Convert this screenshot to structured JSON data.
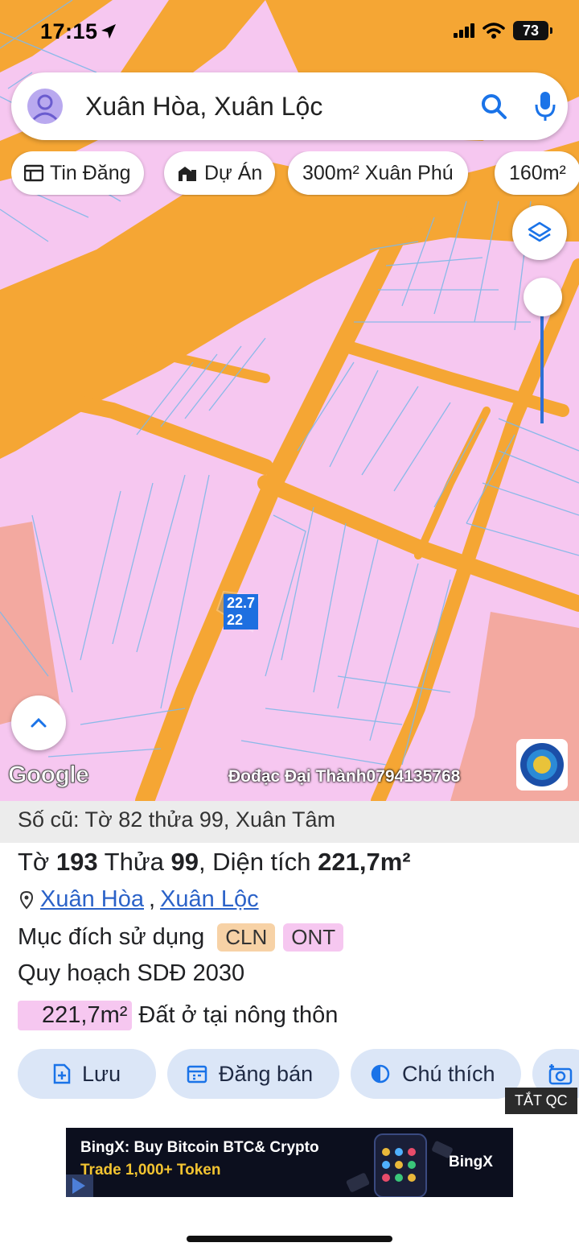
{
  "status_bar": {
    "time": "17:15",
    "battery": "73"
  },
  "search": {
    "value": "Xuân Hòa, Xuân Lộc"
  },
  "chips": [
    {
      "label": "Tin Đăng",
      "icon": "listing-icon"
    },
    {
      "label": "Dự Án",
      "icon": "building-icon"
    },
    {
      "label": "300m² Xuân Phú"
    },
    {
      "label": "160m²"
    }
  ],
  "map": {
    "parcel_label_line1": "22.7",
    "parcel_label_line2": "22",
    "watermark": "Đođạc Đại Thành0794135768",
    "google_logo": "Google",
    "colors": {
      "residential": "#f6c7f0",
      "road": "#f5a634",
      "commercial": "#f3a9a0",
      "parcel_line": "#7fb8e8"
    }
  },
  "panel": {
    "old_ref": "Số cũ: Tờ 82 thửa 99, Xuân Tâm",
    "title": {
      "sheet_label": "Tờ ",
      "sheet": "193",
      "parcel_label": " Thửa ",
      "parcel": "99",
      "area_label": ", Diện tích ",
      "area": "221,7m²"
    },
    "address": {
      "commune": "Xuân Hòa",
      "separator": ",",
      "district": "Xuân Lộc"
    },
    "purpose_label": "Mục đích sử dụng",
    "purpose_tags": [
      "CLN",
      "ONT"
    ],
    "plan_label": "Quy hoạch SDĐ 2030",
    "area_value": "221,7m²",
    "area_desc": "Đất ở tại nông thôn",
    "actions": [
      {
        "label": "Lưu",
        "icon": "add-file-icon"
      },
      {
        "label": "Đăng bán",
        "icon": "calendar-icon"
      },
      {
        "label": "Chú thích",
        "icon": "contrast-icon"
      }
    ],
    "hide_ads": "TẮT QC"
  },
  "ad": {
    "line1": "BingX: Buy Bitcoin BTC& Crypto",
    "line2": "Trade 1,000+ Token",
    "brand": "BingX"
  }
}
